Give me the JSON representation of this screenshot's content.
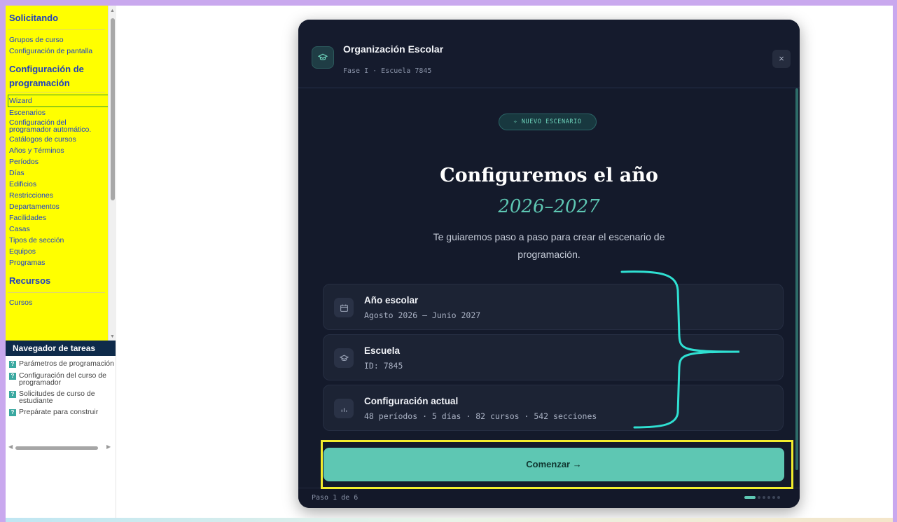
{
  "sidebar": {
    "sections": [
      {
        "title": "Solicitando",
        "items": [
          "Grupos de curso",
          "Configuración de pantalla"
        ]
      },
      {
        "title": "Configuración de programación",
        "items": [
          "Wizard",
          "Escenarios",
          "Configuración del programador automático.",
          "Catálogos de cursos",
          "Años y Términos",
          "Períodos",
          "Días",
          "Edificios",
          "Restricciones",
          "Departamentos",
          "Facilidades",
          "Casas",
          "Tipos de sección",
          "Equipos",
          "Programas"
        ]
      },
      {
        "title": "Recursos",
        "items": [
          "Cursos"
        ]
      }
    ],
    "active_item": "Wizard"
  },
  "task_navigator": {
    "title": "Navegador de tareas",
    "items": [
      "Parámetros de programación",
      "Configuración del curso de programador",
      "Solicitudes de curso de estudiante",
      "Prepárate para construir"
    ]
  },
  "modal": {
    "header": {
      "title": "Organización Escolar",
      "subtitle": "Fase I · Escuela 7845",
      "close_label": "×"
    },
    "badge": "✧ NUEVO ESCENARIO",
    "title": "Configuremos el año",
    "year": "2026–2027",
    "description": "Te guiaremos paso a paso para crear el escenario de programación.",
    "cards": [
      {
        "icon": "calendar-icon",
        "title": "Año escolar",
        "value": "Agosto 2026 – Junio 2027"
      },
      {
        "icon": "graduation-cap-icon",
        "title": "Escuela",
        "value": "ID: 7845"
      },
      {
        "icon": "bar-chart-icon",
        "title": "Configuración actual",
        "value": "48 períodos · 5 días · 82 cursos · 542 secciones"
      }
    ],
    "start_button": "Comenzar →",
    "footer": {
      "step": "Paso 1 de 6",
      "total_steps": 6,
      "current_step": 1
    }
  },
  "colors": {
    "accent": "#5ec7b3",
    "modal_bg": "#141a2b",
    "sidebar_bg": "#ffff00",
    "highlight_box": "#f2ec2c",
    "annotation_brace": "#2fe0d2"
  }
}
